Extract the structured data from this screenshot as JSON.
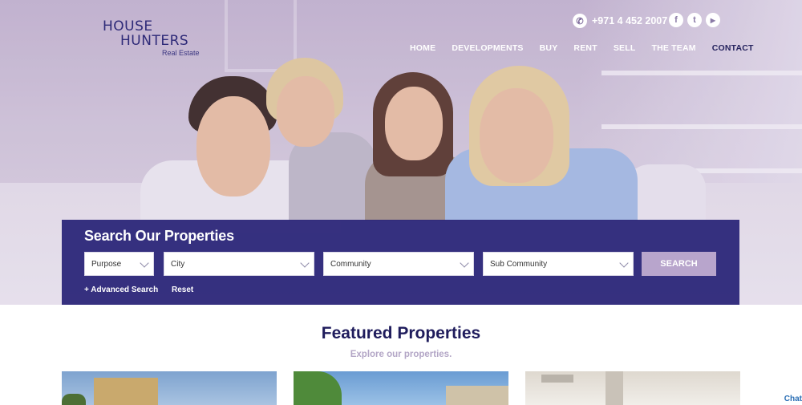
{
  "brand": {
    "line1": "HOUSE",
    "line2": "HUNTERS",
    "line3": "Real Estate"
  },
  "header": {
    "phone": "+971 4 452 2007",
    "social": [
      {
        "icon": "facebook-icon",
        "glyph": "f"
      },
      {
        "icon": "twitter-icon",
        "glyph": "t"
      },
      {
        "icon": "youtube-icon",
        "glyph": "▶"
      }
    ],
    "nav": [
      "HOME",
      "DEVELOPMENTS",
      "BUY",
      "RENT",
      "SELL",
      "THE TEAM",
      "CONTACT"
    ]
  },
  "search": {
    "title": "Search Our Properties",
    "fields": [
      "Purpose",
      "City",
      "Community",
      "Sub Community"
    ],
    "button": "SEARCH",
    "advanced": "+ Advanced Search",
    "reset": "Reset"
  },
  "featured": {
    "title": "Featured Properties",
    "subtitle": "Explore our properties."
  },
  "chat": {
    "label": "Chat"
  },
  "colors": {
    "primary": "#2b2576",
    "accent": "#b8a5cc",
    "heading": "#1f1c5c"
  }
}
